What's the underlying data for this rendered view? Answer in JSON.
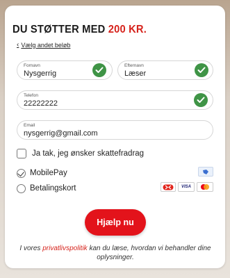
{
  "form": {
    "title_prefix": "DU STØTTER MED",
    "title_amount": "200 KR.",
    "back_link": "Vælg andet beløb",
    "fields": {
      "first_name": {
        "label": "Fornavn",
        "value": "Nysgerrig"
      },
      "last_name": {
        "label": "Efternavn",
        "value": "Læser"
      },
      "phone": {
        "label": "Telefon",
        "value": "22222222"
      },
      "email": {
        "label": "Email",
        "value": "nysgerrig@gmail.com"
      }
    },
    "tax_deduction_label": "Ja tak, jeg ønsker skattefradrag",
    "payment_methods": [
      {
        "label": "MobilePay",
        "selected": true,
        "icons": [
          "mobilepay-icon"
        ]
      },
      {
        "label": "Betalingskort",
        "selected": false,
        "icons": [
          "dankort-icon",
          "visa-icon",
          "mastercard-icon"
        ]
      }
    ],
    "visa_text": "VISA",
    "submit_label": "Hjælp nu",
    "footer": {
      "before": "I vores ",
      "link": "privatlivspolitik",
      "after": " kan du læse, hvordan vi behandler dine oplysninger."
    },
    "colors": {
      "accent": "#d6231c",
      "button": "#e3131b",
      "valid": "#3f9446"
    }
  }
}
